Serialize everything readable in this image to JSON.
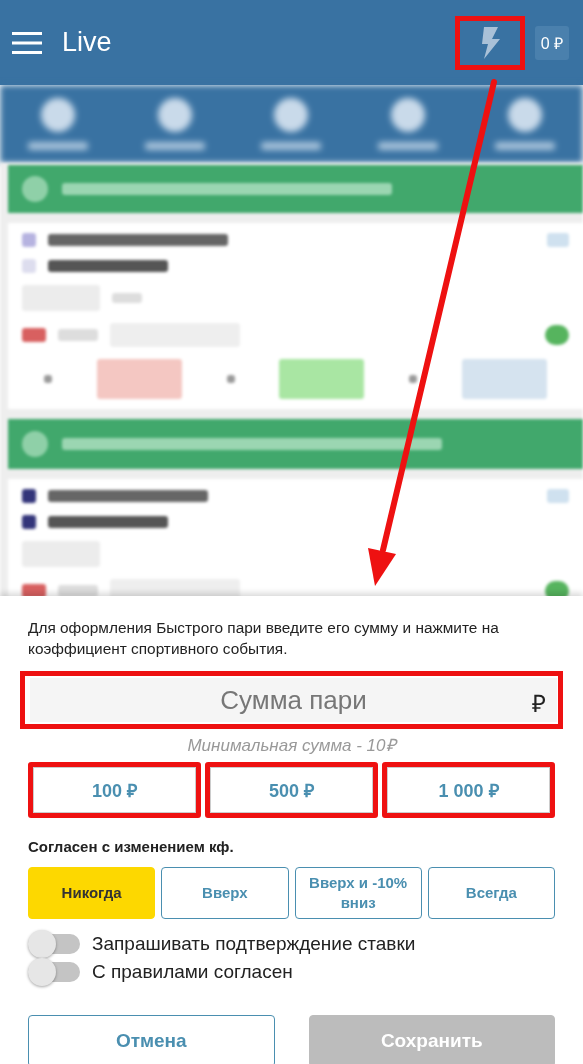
{
  "header": {
    "title": "Live",
    "balance": "0 ₽"
  },
  "bet_sheet": {
    "description": "Для оформления Быстрого пари введите его сумму и нажмите на коэффициент спортивного события.",
    "amount_field": {
      "placeholder": "Сумма пари",
      "currency": "₽"
    },
    "hint": "Минимальная сумма - 10₽",
    "quick_amounts": [
      "100 ₽",
      "500 ₽",
      "1 000 ₽"
    ],
    "odds_change_label": "Согласен с изменением кф.",
    "odds_change_options": [
      {
        "label": "Никогда",
        "selected": true
      },
      {
        "label": "Вверх",
        "selected": false
      },
      {
        "label": "Вверх и -10% вниз",
        "selected": false
      },
      {
        "label": "Всегда",
        "selected": false
      }
    ],
    "toggles": [
      {
        "label": "Запрашивать подтверждение ставки",
        "on": false
      },
      {
        "label": "С правилами согласен",
        "on": false
      }
    ],
    "buttons": [
      {
        "label": "Отмена",
        "disabled": false
      },
      {
        "label": "Сохранить",
        "disabled": true
      }
    ]
  }
}
